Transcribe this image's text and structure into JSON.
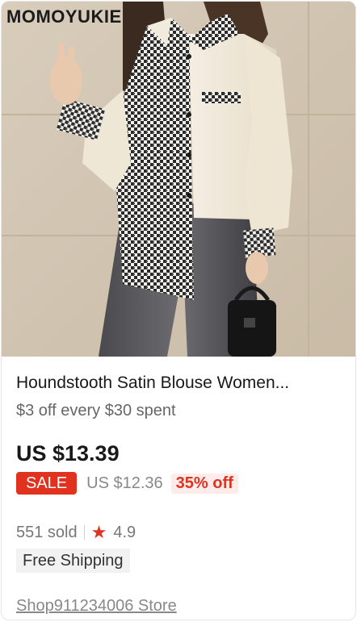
{
  "product": {
    "image_brand": "MOMOYUKIE",
    "title": "Houndstooth Satin Blouse Women...",
    "promo": "$3 off every $30 spent",
    "price": "US $13.39",
    "sale_badge": "SALE",
    "original_price": "US $12.36",
    "discount": "35% off",
    "sold": "551 sold",
    "rating": "4.9",
    "shipping": "Free Shipping",
    "store": "Shop911234006 Store"
  },
  "colors": {
    "accent": "#e0321f",
    "text": "#191919",
    "muted": "#888888"
  },
  "icons": {
    "rating": "star-icon"
  }
}
